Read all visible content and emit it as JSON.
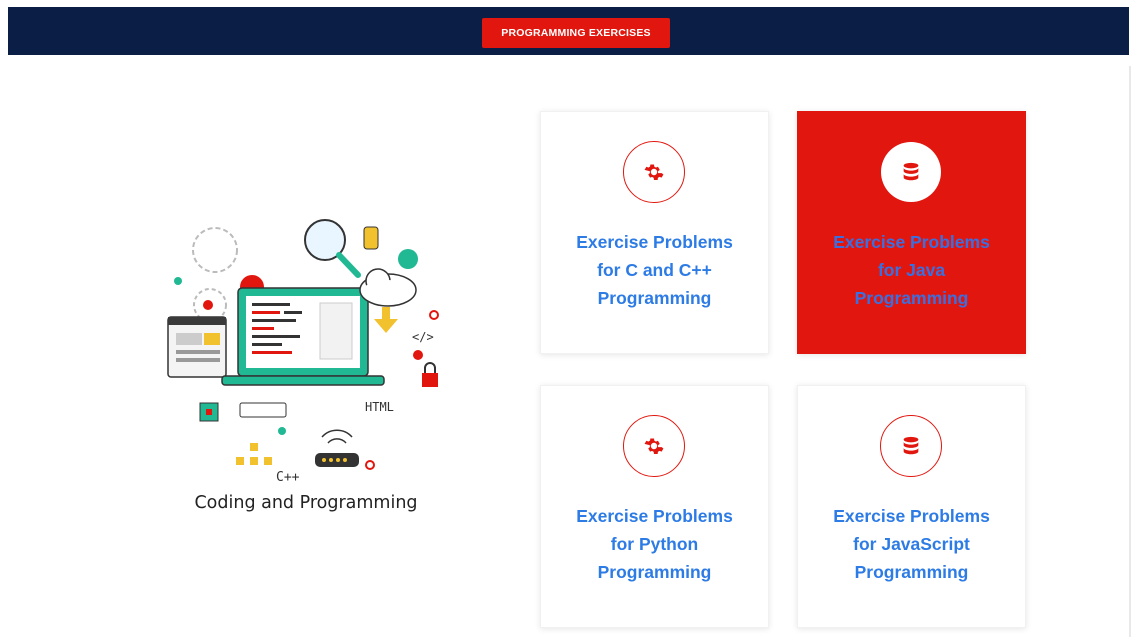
{
  "header": {
    "button_label": "PROGRAMMING EXERCISES"
  },
  "illustration": {
    "caption": "Coding and Programming",
    "label_html": "HTML",
    "label_cpp": "C++",
    "label_tag": "</>"
  },
  "cards": [
    {
      "title_line1": "Exercise Problems",
      "title_line2": "for C and C++",
      "title_line3": "Programming",
      "icon": "gear-icon",
      "active": false
    },
    {
      "title_line1": "Exercise Problems",
      "title_line2": "for Java",
      "title_line3": "Programming",
      "icon": "database-icon",
      "active": true
    },
    {
      "title_line1": "Exercise Problems",
      "title_line2": "for Python",
      "title_line3": "Programming",
      "icon": "gear-icon",
      "active": false
    },
    {
      "title_line1": "Exercise Problems",
      "title_line2": "for JavaScript",
      "title_line3": "Programming",
      "icon": "database-icon",
      "active": false
    }
  ],
  "colors": {
    "navbar": "#0b1e45",
    "accent_red": "#e1170f",
    "link_blue": "#2d7be5"
  }
}
